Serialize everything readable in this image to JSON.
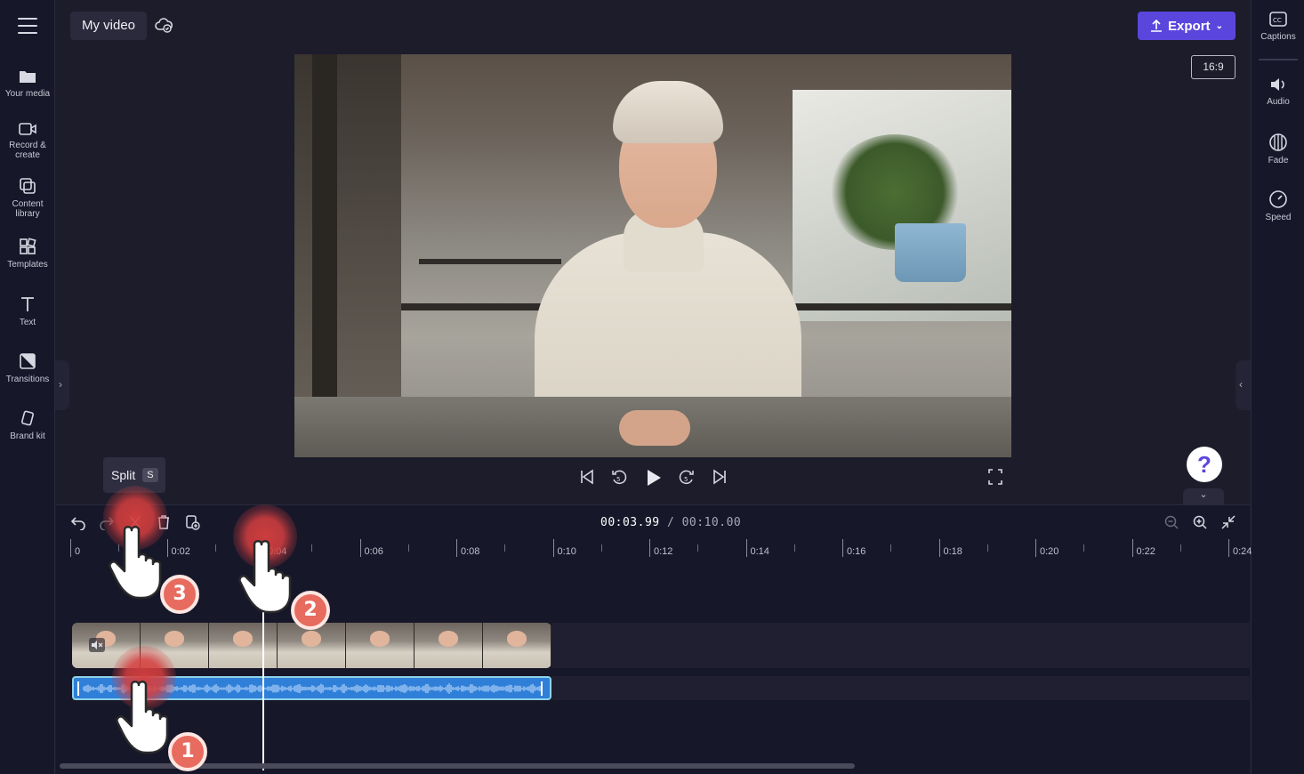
{
  "project": {
    "title": "My video"
  },
  "toolbar": {
    "export_label": "Export",
    "aspect_ratio": "16:9"
  },
  "left_rail": {
    "items": [
      {
        "label": "Your media",
        "icon": "folder-icon"
      },
      {
        "label": "Record &",
        "label2": "create",
        "icon": "camera-icon"
      },
      {
        "label": "Content",
        "label2": "library",
        "icon": "library-icon"
      },
      {
        "label": "Templates",
        "icon": "templates-icon"
      },
      {
        "label": "Text",
        "icon": "text-icon"
      },
      {
        "label": "Transitions",
        "icon": "transitions-icon"
      },
      {
        "label": "Brand kit",
        "icon": "brand-kit-icon"
      }
    ]
  },
  "right_rail": {
    "items": [
      {
        "label": "Captions",
        "icon": "captions-icon"
      },
      {
        "label": "Audio",
        "icon": "audio-icon"
      },
      {
        "label": "Fade",
        "icon": "fade-icon"
      },
      {
        "label": "Speed",
        "icon": "speed-icon"
      }
    ]
  },
  "player": {
    "current_time": "00:03.99",
    "total_time": "/ 00:10.00",
    "help_label": "?"
  },
  "tooltip": {
    "label": "Split",
    "shortcut": "S"
  },
  "ruler": {
    "labels": [
      "0",
      "0:02",
      "0:04",
      "0:06",
      "0:08",
      "0:10",
      "0:12",
      "0:14",
      "0:16",
      "0:18",
      "0:20",
      "0:22",
      "0:24"
    ]
  },
  "tutorial": {
    "steps": [
      "1",
      "2",
      "3"
    ]
  }
}
